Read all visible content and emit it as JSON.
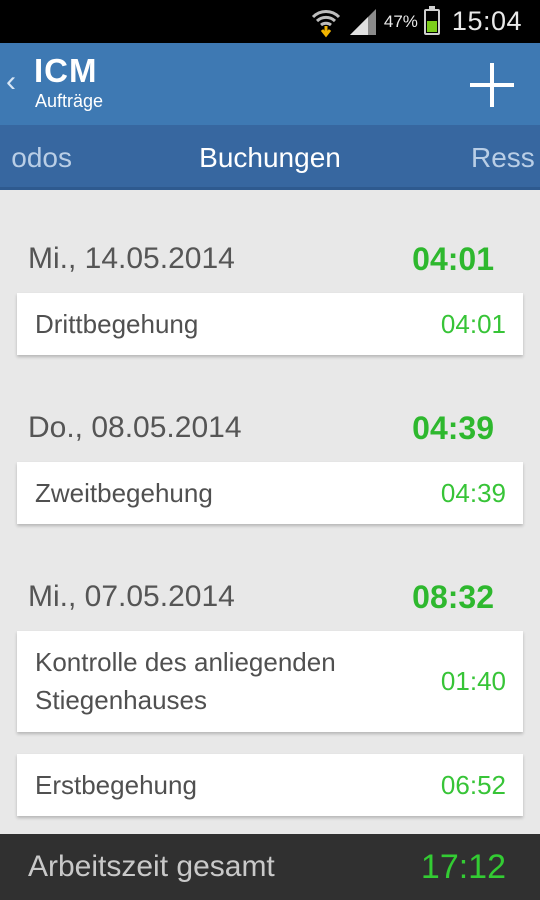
{
  "status_bar": {
    "battery_percent": "47%",
    "time": "15:04",
    "battery_level": 0.47,
    "icons": [
      "wifi-download-icon",
      "signal-icon",
      "battery-icon"
    ]
  },
  "action_bar": {
    "back_icon": "chevron-left-icon",
    "title": "ICM",
    "subtitle": "Aufträge",
    "add_icon": "plus-icon"
  },
  "tabs": {
    "left": "odos",
    "active": "Buchungen",
    "right": "Ress"
  },
  "groups": [
    {
      "date": "Mi., 14.05.2014",
      "total": "04:01",
      "entries": [
        {
          "label": "Drittbegehung",
          "time": "04:01"
        }
      ]
    },
    {
      "date": "Do., 08.05.2014",
      "total": "04:39",
      "entries": [
        {
          "label": "Zweitbegehung",
          "time": "04:39"
        }
      ]
    },
    {
      "date": "Mi., 07.05.2014",
      "total": "08:32",
      "entries": [
        {
          "label": "Kontrolle des anliegenden Stiegenhauses",
          "time": "01:40"
        },
        {
          "label": "Erstbegehung",
          "time": "06:52"
        }
      ]
    }
  ],
  "footer": {
    "label": "Arbeitszeit gesamt",
    "total": "17:12"
  },
  "colors": {
    "action_bar": "#3e79b3",
    "tab_strip": "#3767a0",
    "accent_green": "#2eb82e",
    "footer": "#303030"
  }
}
